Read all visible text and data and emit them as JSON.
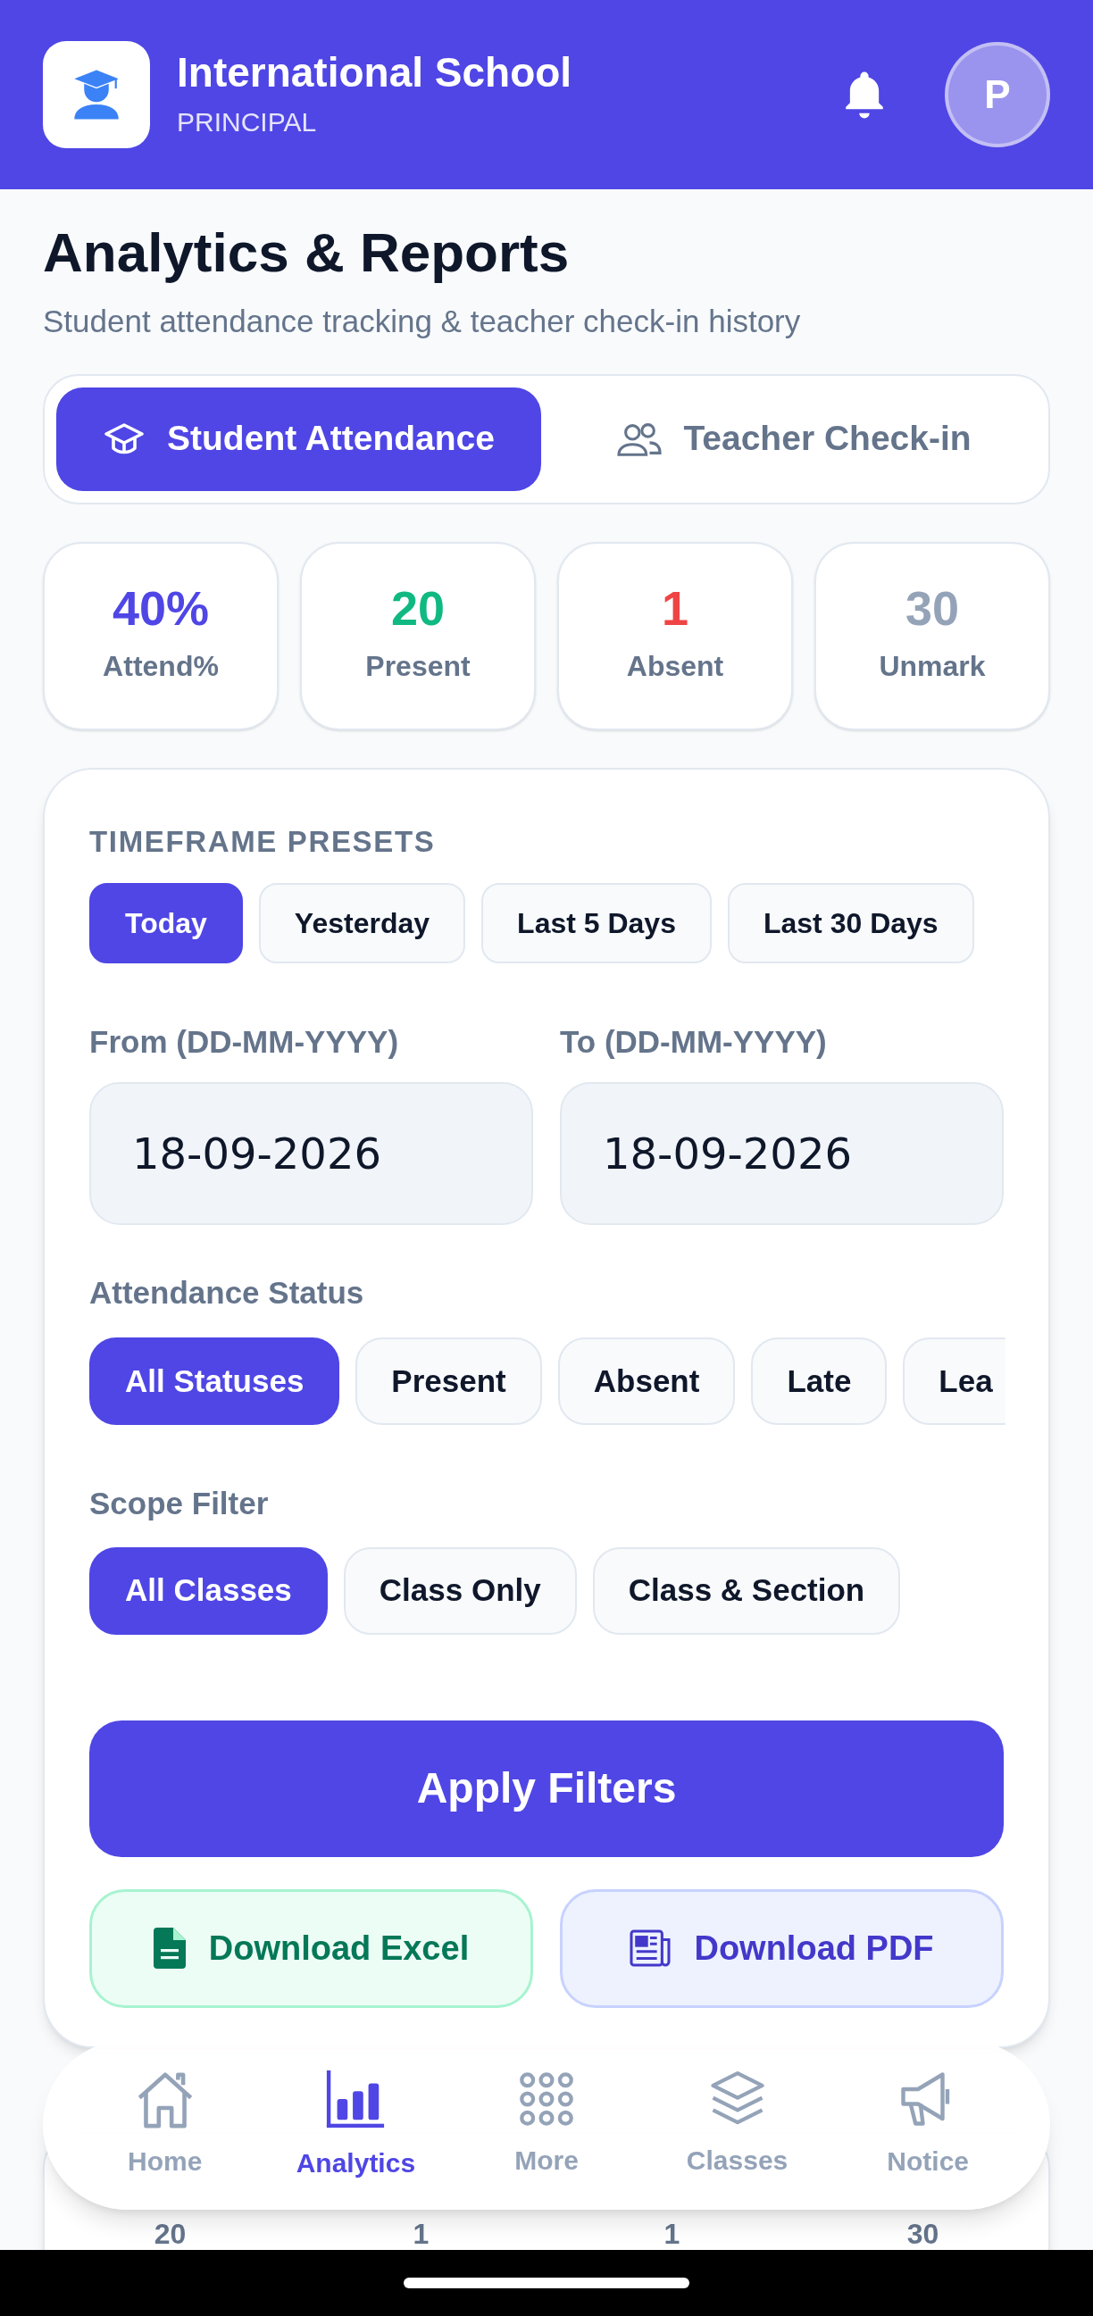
{
  "header": {
    "school": "International School",
    "role": "PRINCIPAL",
    "avatar": "P"
  },
  "title": "Analytics & Reports",
  "subtitle": "Student attendance tracking & teacher check-in history",
  "tabs": [
    {
      "label": "Student Attendance",
      "kind": "student",
      "selected": true
    },
    {
      "label": "Teacher Check-in",
      "kind": "teacher",
      "selected": false
    }
  ],
  "stats": [
    {
      "value": "40%",
      "label": "Attend%",
      "color": "#4f46e5"
    },
    {
      "value": "20",
      "label": "Present",
      "color": "#10b981"
    },
    {
      "value": "1",
      "label": "Absent",
      "color": "#ef4444"
    },
    {
      "value": "30",
      "label": "Unmark",
      "color": "#94a3b8"
    }
  ],
  "filters": {
    "presets_label": "TIMEFRAME PRESETS",
    "presets": [
      {
        "label": "Today",
        "selected": true
      },
      {
        "label": "Yesterday",
        "selected": false
      },
      {
        "label": "Last 5 Days",
        "selected": false
      },
      {
        "label": "Last 30 Days",
        "selected": false
      }
    ],
    "from": {
      "label": "From (DD-MM-YYYY)",
      "value": "18-09-2026"
    },
    "to": {
      "label": "To (DD-MM-YYYY)",
      "value": "18-09-2026"
    },
    "status_label": "Attendance Status",
    "statuses": [
      {
        "label": "All Statuses",
        "selected": true
      },
      {
        "label": "Present",
        "selected": false
      },
      {
        "label": "Absent",
        "selected": false
      },
      {
        "label": "Late",
        "selected": false
      },
      {
        "label": "Lea",
        "selected": false
      }
    ],
    "scope_label": "Scope Filter",
    "scopes": [
      {
        "label": "All Classes",
        "selected": true
      },
      {
        "label": "Class Only",
        "selected": false
      },
      {
        "label": "Class & Section",
        "selected": false
      }
    ],
    "apply": "Apply Filters",
    "downloads": [
      {
        "label": "Download Excel",
        "kind": "excel"
      },
      {
        "label": "Download PDF",
        "kind": "pdf"
      }
    ]
  },
  "distribution_values": [
    "20",
    "1",
    "1",
    "30"
  ],
  "nav": [
    {
      "label": "Home",
      "kind": "home",
      "selected": false
    },
    {
      "label": "Analytics",
      "kind": "analytics",
      "selected": true
    },
    {
      "label": "More",
      "kind": "more",
      "selected": false
    },
    {
      "label": "Classes",
      "kind": "classes",
      "selected": false
    },
    {
      "label": "Notice",
      "kind": "notice",
      "selected": false
    }
  ]
}
